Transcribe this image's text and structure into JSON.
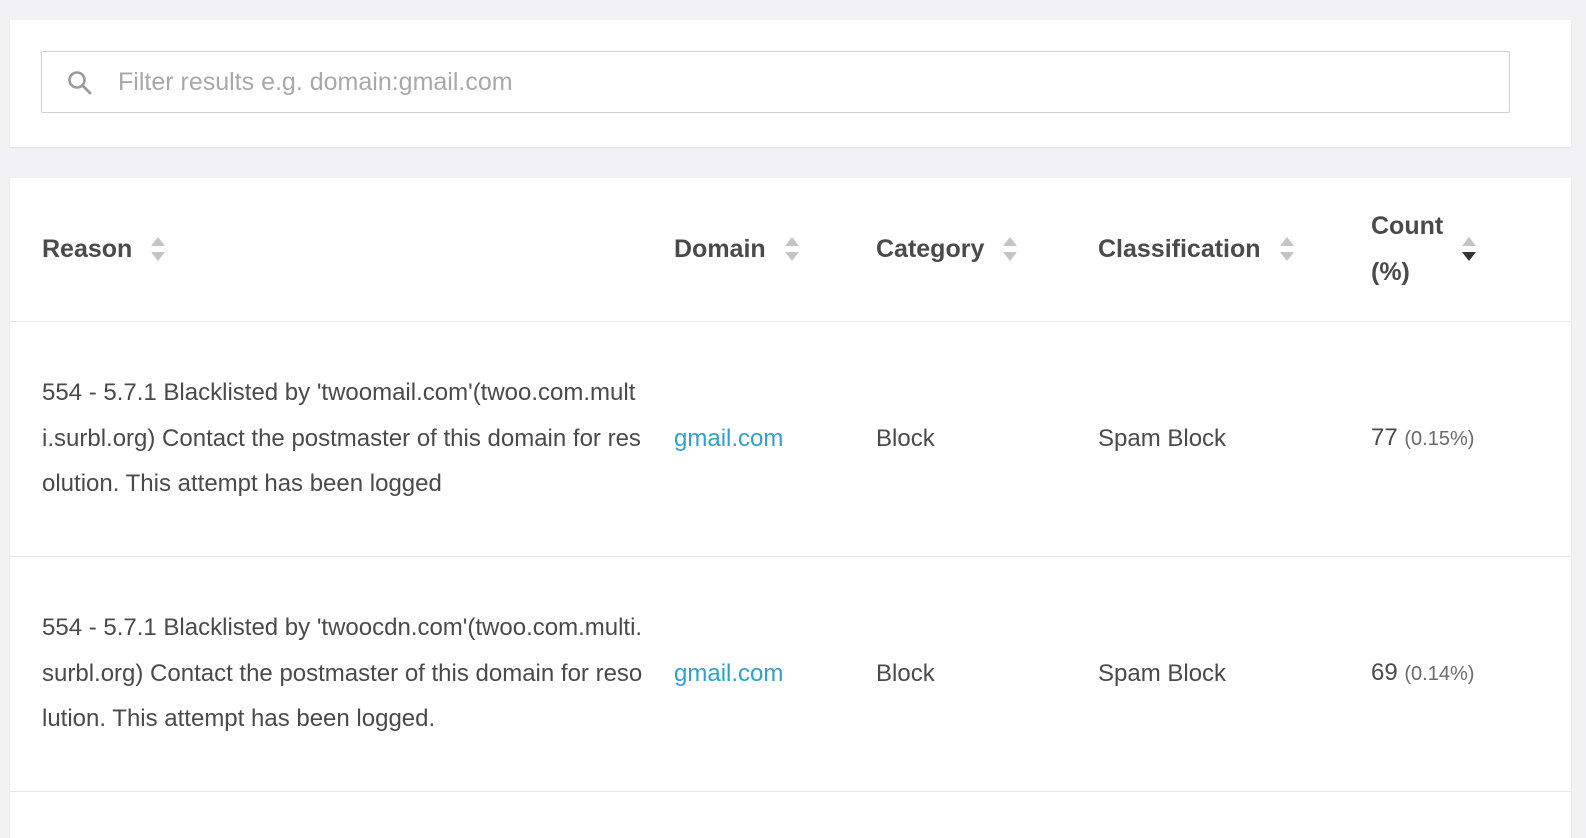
{
  "filter": {
    "placeholder": "Filter results e.g. domain:gmail.com",
    "icon": "search-icon"
  },
  "table": {
    "columns": [
      {
        "label": "Reason",
        "sort": "none"
      },
      {
        "label": "Domain",
        "sort": "none"
      },
      {
        "label": "Category",
        "sort": "none"
      },
      {
        "label": "Classification",
        "sort": "none"
      },
      {
        "label": "Count (%)",
        "sort": "desc"
      }
    ],
    "rows": [
      {
        "reason": "554 - 5.7.1 Blacklisted by 'twoomail.com'(twoo.com.multi.surbl.org) Contact the postmaster of this domain for resolution. This attempt has been logged",
        "domain": "gmail.com",
        "category": "Block",
        "classification": "Spam Block",
        "count": "77",
        "percent": "(0.15%)"
      },
      {
        "reason": "554 - 5.7.1 Blacklisted by 'twoocdn.com'(twoo.com.multi.surbl.org) Contact the postmaster of this domain for resolution. This attempt has been logged.",
        "domain": "gmail.com",
        "category": "Block",
        "classification": "Spam Block",
        "count": "69",
        "percent": "(0.14%)"
      }
    ]
  },
  "colors": {
    "link": "#2ea2cc",
    "text": "#4a4a4a",
    "background": "#f2f2f4",
    "sort_inactive": "#c4c4c4",
    "sort_active": "#333333"
  }
}
